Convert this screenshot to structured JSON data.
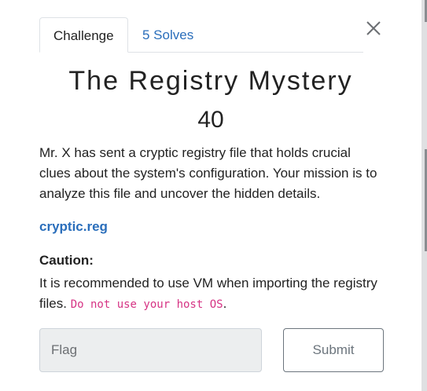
{
  "tabs": [
    {
      "label": "Challenge",
      "active": true
    },
    {
      "label": "5 Solves",
      "active": false
    }
  ],
  "close_icon": "close-icon",
  "challenge": {
    "title": "The Registry Mystery",
    "points": "40",
    "description": "Mr. X has sent a cryptic registry file that holds crucial clues about the system's configuration. Your mission is to analyze this file and uncover the hidden details.",
    "file_link": "cryptic.reg",
    "caution_heading": "Caution:",
    "caution_text": "It is recommended to use VM when importing the registry files.",
    "caution_code": "Do not use your host OS",
    "caution_end": "."
  },
  "form": {
    "flag_placeholder": "Flag",
    "submit_label": "Submit"
  },
  "colors": {
    "link": "#2a6ebb",
    "code": "#d63384",
    "input_bg": "#eceeef",
    "button_border": "#6c757d"
  }
}
